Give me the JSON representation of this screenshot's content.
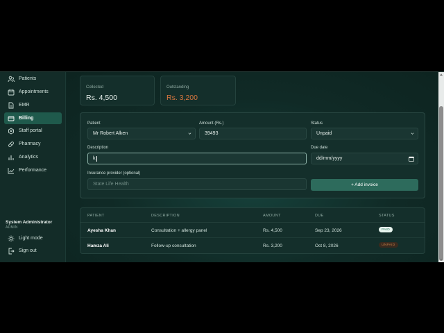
{
  "sidebar": {
    "items": [
      {
        "label": "Patients",
        "icon": "users-icon"
      },
      {
        "label": "Appointments",
        "icon": "calendar-icon"
      },
      {
        "label": "EMR",
        "icon": "document-icon"
      },
      {
        "label": "Billing",
        "icon": "card-icon",
        "active": true
      },
      {
        "label": "Staff portal",
        "icon": "id-badge-icon"
      },
      {
        "label": "Pharmacy",
        "icon": "pill-icon"
      },
      {
        "label": "Analytics",
        "icon": "bar-chart-icon"
      },
      {
        "label": "Performance",
        "icon": "trend-icon"
      }
    ],
    "user": {
      "name": "System Administrator",
      "role": "ADMIN"
    },
    "bottom": [
      {
        "label": "Light mode",
        "icon": "sun-icon"
      },
      {
        "label": "Sign out",
        "icon": "sign-out-icon"
      }
    ]
  },
  "stats": {
    "collected": {
      "label": "Collected",
      "value": "Rs. 4,500",
      "color": "#e8f0ec"
    },
    "outstanding": {
      "label": "Outstanding",
      "value": "Rs. 3,200",
      "color": "#d9773f"
    }
  },
  "form": {
    "patient_label": "Patient",
    "patient_value": "Mr Robert Alken",
    "amount_label": "Amount (Rs.)",
    "amount_value": "39493",
    "status_label": "Status",
    "status_value": "Unpaid",
    "description_label": "Description",
    "description_value": "k",
    "due_label": "Due date",
    "due_placeholder": "dd/mm/yyyy",
    "insurance_label": "Insurance provider (optional)",
    "insurance_placeholder": "State Life Health",
    "submit_label": "+ Add invoice"
  },
  "table": {
    "headers": [
      "PATIENT",
      "DESCRIPTION",
      "AMOUNT",
      "DUE",
      "STATUS"
    ],
    "rows": [
      {
        "patient": "Ayesha Khan",
        "description": "Consultation + allergy panel",
        "amount": "Rs. 4,500",
        "due": "Sep 23, 2026",
        "status": "PAID"
      },
      {
        "patient": "Hamza Ali",
        "description": "Follow-up consultation",
        "amount": "Rs. 3,200",
        "due": "Oct 8, 2026",
        "status": "UNPAID"
      }
    ]
  },
  "colors": {
    "accent": "#2d6b5c",
    "active_nav": "#1f5a4c",
    "outstanding": "#d9773f"
  }
}
